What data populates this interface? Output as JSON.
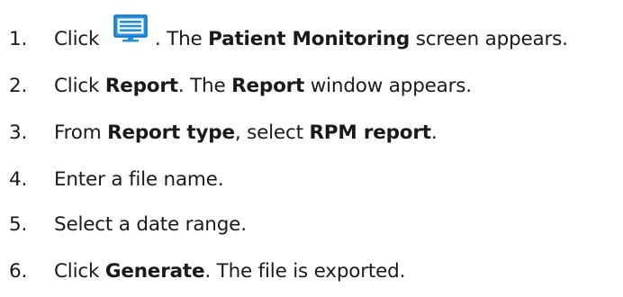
{
  "steps": [
    {
      "number": "1.",
      "parts": [
        {
          "type": "text",
          "text": "Click "
        },
        {
          "type": "icon",
          "icon": "patient-monitoring-list-icon",
          "color": "#1e90e6"
        },
        {
          "type": "text",
          "text": ". The "
        },
        {
          "type": "bold",
          "text": "Patient Monitoring"
        },
        {
          "type": "text",
          "text": " screen appears."
        }
      ]
    },
    {
      "number": "2.",
      "parts": [
        {
          "type": "text",
          "text": "Click "
        },
        {
          "type": "bold",
          "text": "Report"
        },
        {
          "type": "text",
          "text": ". The "
        },
        {
          "type": "bold",
          "text": "Report"
        },
        {
          "type": "text",
          "text": " window appears."
        }
      ]
    },
    {
      "number": "3.",
      "parts": [
        {
          "type": "text",
          "text": "From "
        },
        {
          "type": "bold",
          "text": "Report type"
        },
        {
          "type": "text",
          "text": ", select "
        },
        {
          "type": "bold",
          "text": "RPM report"
        },
        {
          "type": "text",
          "text": "."
        }
      ]
    },
    {
      "number": "4.",
      "parts": [
        {
          "type": "text",
          "text": "Enter a file name."
        }
      ]
    },
    {
      "number": "5.",
      "parts": [
        {
          "type": "text",
          "text": "Select a date range."
        }
      ]
    },
    {
      "number": "6.",
      "parts": [
        {
          "type": "text",
          "text": "Click "
        },
        {
          "type": "bold",
          "text": "Generate"
        },
        {
          "type": "text",
          "text": ". The file is exported."
        }
      ]
    }
  ]
}
